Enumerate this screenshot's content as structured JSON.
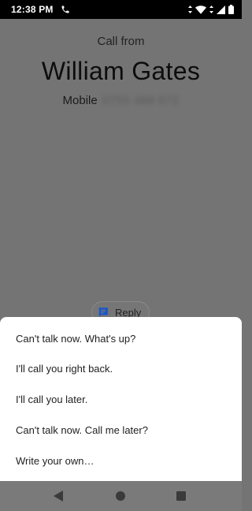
{
  "status_bar": {
    "time": "12:38 PM",
    "icons": [
      "phone-call-icon",
      "wifi-icon",
      "signal-icon",
      "battery-icon"
    ]
  },
  "caller": {
    "header": "Call from",
    "name": "William Gates",
    "number_type": "Mobile",
    "number": "0755 488 672"
  },
  "reply_button": {
    "label": "Reply",
    "icon": "message-icon",
    "icon_color": "#1a56c9"
  },
  "quick_replies": [
    "Can't talk now. What's up?",
    "I'll call you right back.",
    "I'll call you later.",
    "Can't talk now. Call me later?",
    "Write your own…"
  ],
  "nav_bar": {
    "icons": [
      "back-icon",
      "home-icon",
      "recents-icon"
    ]
  }
}
